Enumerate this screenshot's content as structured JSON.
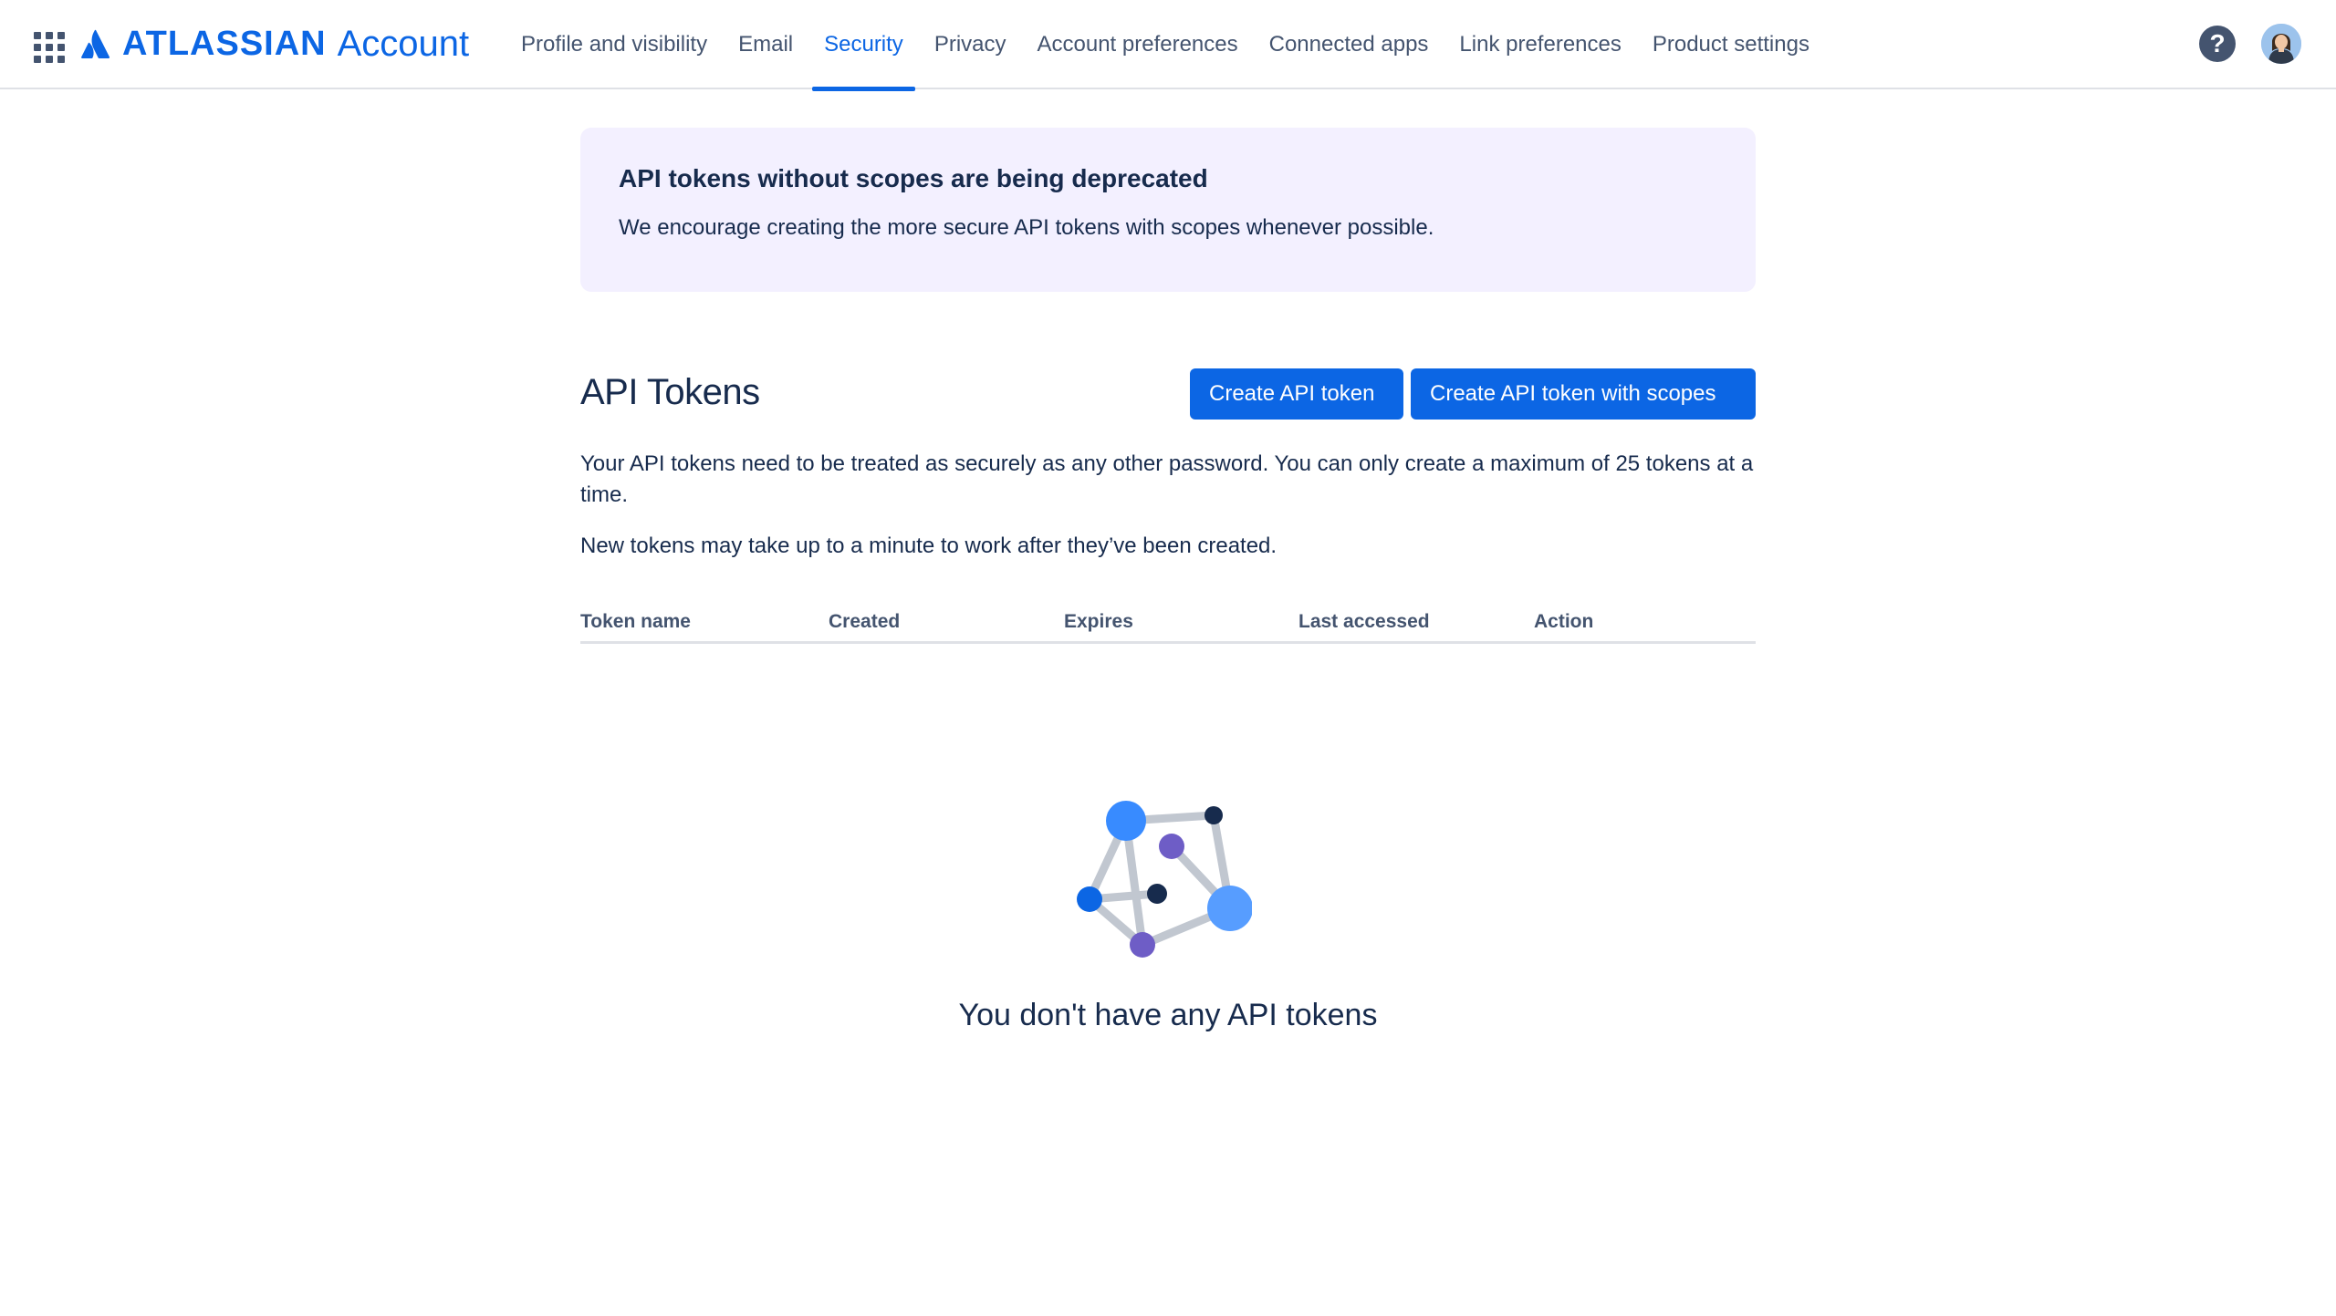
{
  "header": {
    "logo_word": "ATLASSIAN",
    "logo_product": "Account",
    "nav": [
      {
        "label": "Profile and visibility"
      },
      {
        "label": "Email"
      },
      {
        "label": "Security"
      },
      {
        "label": "Privacy"
      },
      {
        "label": "Account preferences"
      },
      {
        "label": "Connected apps"
      },
      {
        "label": "Link preferences"
      },
      {
        "label": "Product settings"
      }
    ],
    "active_tab": "Security",
    "help_glyph": "?"
  },
  "banner": {
    "title": "API tokens without scopes are being deprecated",
    "text": "We encourage creating the more secure API tokens with scopes whenever possible."
  },
  "tokens": {
    "title": "API Tokens",
    "create_label": "Create API token",
    "create_scopes_label": "Create API token with scopes",
    "description": "Your API tokens need to be treated as securely as any other password. You can only create a maximum of 25 tokens at a time.",
    "note": "New tokens may take up to a minute to work after they’ve been created.",
    "columns": [
      "Token name",
      "Created",
      "Expires",
      "Last accessed",
      "Action"
    ],
    "rows": [],
    "empty_message": "You don't have any API tokens"
  },
  "colors": {
    "accent": "#0c66e4",
    "banner_bg": "#f3f0ff",
    "text": "#172b4d",
    "subtle_text": "#44546f"
  }
}
